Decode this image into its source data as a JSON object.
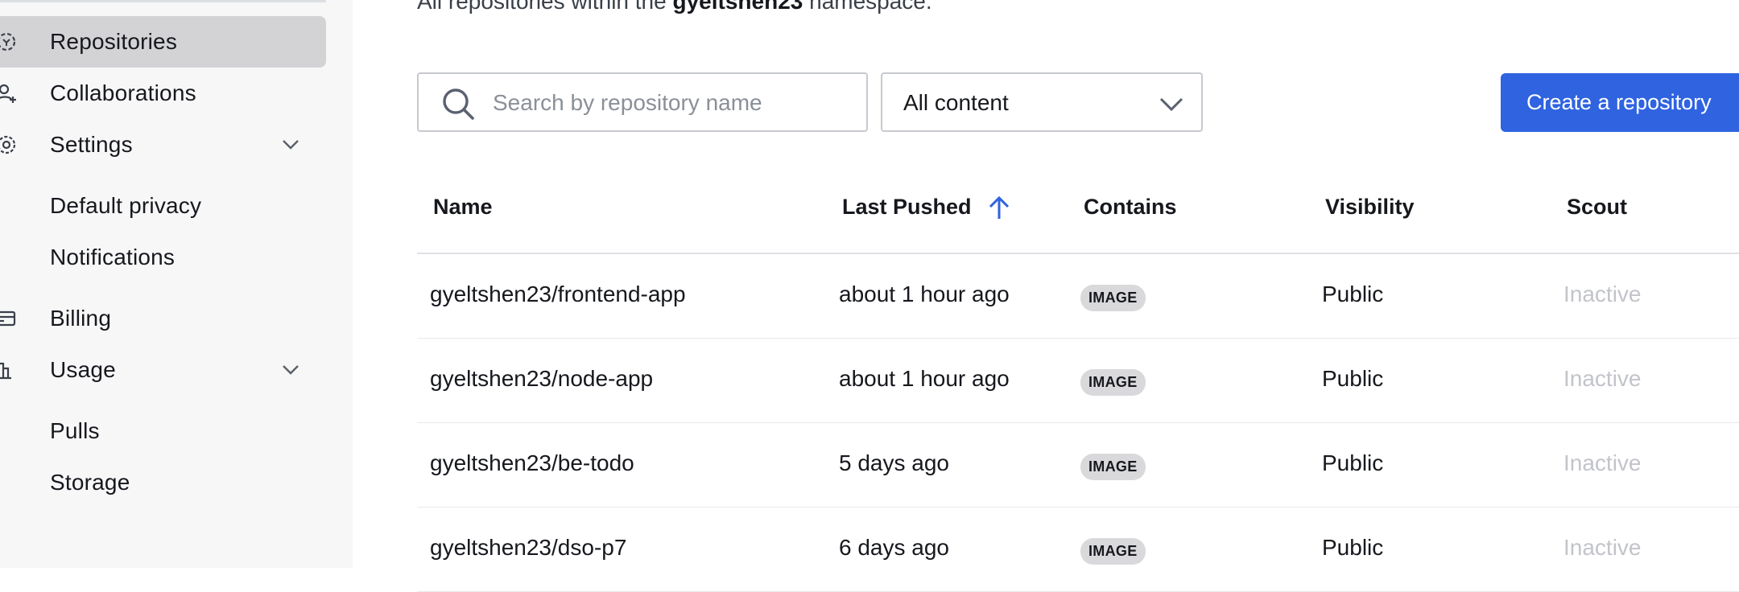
{
  "sidebar": {
    "items": [
      {
        "label": "Repositories",
        "icon": "repository-icon",
        "active": true
      },
      {
        "label": "Collaborations",
        "icon": "collaborators-icon"
      },
      {
        "label": "Settings",
        "icon": "gear-icon",
        "expandable": true
      },
      {
        "label": "Default privacy"
      },
      {
        "label": "Notifications"
      },
      {
        "label": "Billing",
        "icon": "credit-card-icon"
      },
      {
        "label": "Usage",
        "icon": "bar-chart-icon",
        "expandable": true
      },
      {
        "label": "Pulls"
      },
      {
        "label": "Storage"
      }
    ]
  },
  "main": {
    "subtitle_pre": "All repositories within the",
    "subtitle_namespace": "gyeltshen23",
    "subtitle_post": "namespace.",
    "search": {
      "placeholder": "Search by repository name",
      "value": ""
    },
    "filter": {
      "selected": "All content"
    },
    "create_button": "Create a repository",
    "accent_color": "#2f63e0"
  },
  "table": {
    "headers": {
      "name": "Name",
      "last_pushed": "Last Pushed",
      "contains": "Contains",
      "visibility": "Visibility",
      "scout": "Scout"
    },
    "rows": [
      {
        "name": "gyeltshen23/frontend-app",
        "last_pushed": "about 1 hour ago",
        "contains": "IMAGE",
        "visibility": "Public",
        "scout": "Inactive"
      },
      {
        "name": "gyeltshen23/node-app",
        "last_pushed": "about 1 hour ago",
        "contains": "IMAGE",
        "visibility": "Public",
        "scout": "Inactive"
      },
      {
        "name": "gyeltshen23/be-todo",
        "last_pushed": "5 days ago",
        "contains": "IMAGE",
        "visibility": "Public",
        "scout": "Inactive"
      },
      {
        "name": "gyeltshen23/dso-p7",
        "last_pushed": "6 days ago",
        "contains": "IMAGE",
        "visibility": "Public",
        "scout": "Inactive"
      }
    ]
  }
}
